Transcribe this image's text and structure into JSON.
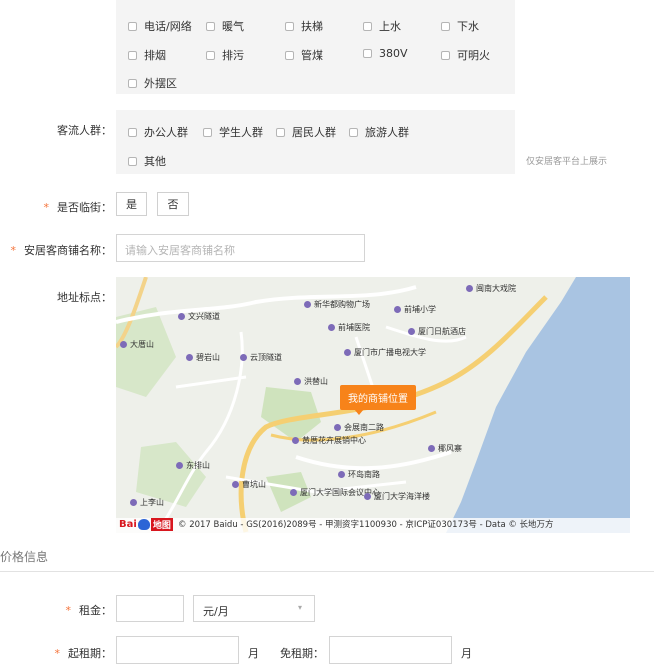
{
  "facilities": {
    "row1": [
      "电话/网络",
      "暖气",
      "扶梯",
      "上水",
      "下水"
    ],
    "row2": [
      "排烟",
      "排污",
      "管煤",
      "380V",
      "可明火"
    ],
    "row3": [
      "外摆区"
    ]
  },
  "crowd": {
    "label": "客流人群：",
    "options": [
      "办公人群",
      "学生人群",
      "居民人群",
      "旅游人群",
      "其他"
    ],
    "hint": "仅安居客平台上展示"
  },
  "street": {
    "label": "是否临街：",
    "yes": "是",
    "no": "否"
  },
  "shop_name": {
    "label": "安居客商铺名称：",
    "placeholder": "请输入安居客商铺名称"
  },
  "map": {
    "label": "地址标点：",
    "marker": "我的商铺位置",
    "places": [
      "闽南大戏院",
      "新华都购物广场",
      "前埔小学",
      "前埔医院",
      "厦门日航酒店",
      "文兴隧道",
      "大厝山",
      "碧岩山",
      "云顶隧道",
      "厦门市广播电视大学",
      "洪替山",
      "会展南二路",
      "黄厝花卉展销中心",
      "椰风寨",
      "东排山",
      "环岛南路",
      "曹坑山",
      "厦门大学国际会议中心",
      "上李山",
      "厦门大学海洋楼"
    ],
    "logo_main": "Bai",
    "logo_map": "地图",
    "copyright": "© 2017 Baidu - GS(2016)2089号 - 甲测资字1100930 - 京ICP证030173号 - Data © 长地万方"
  },
  "price_section": {
    "title": "价格信息"
  },
  "rent": {
    "label": "租金：",
    "unit": "元/月"
  },
  "lease": {
    "start_label": "起租期：",
    "unit1": "月",
    "free_label": "免租期：",
    "unit2": "月"
  }
}
